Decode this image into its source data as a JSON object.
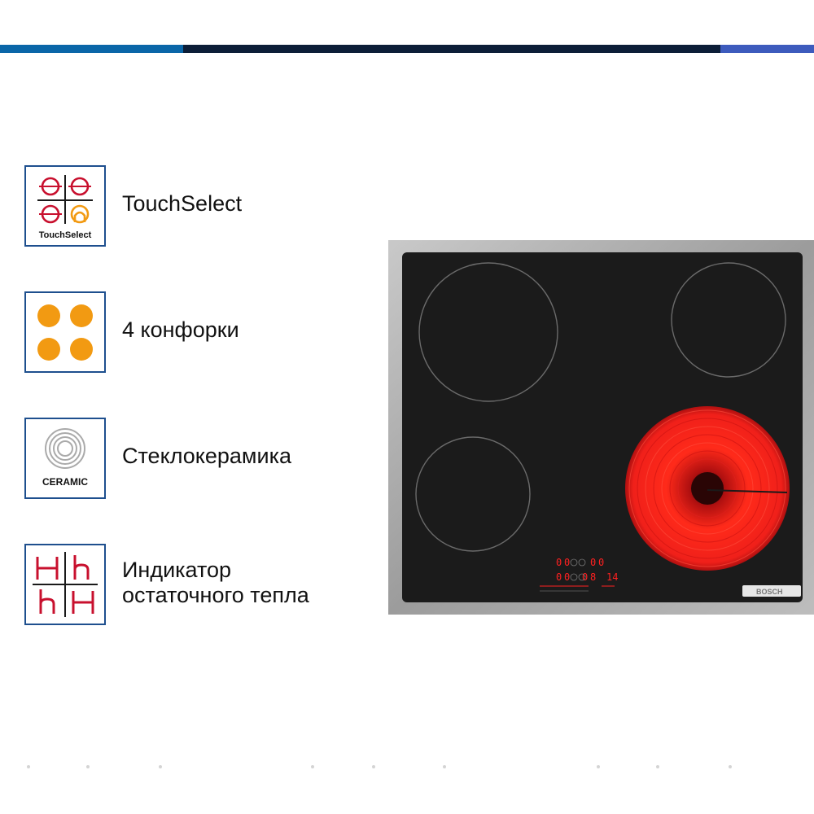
{
  "colors": {
    "bar_light_blue": "#0a66a8",
    "bar_navy": "#0c1e38",
    "bar_blue": "#3d5bbd",
    "icon_border": "#1e4f8e",
    "icon_red": "#c8102e",
    "icon_orange": "#f29a12",
    "burner_red": "#ff2a1a",
    "display_red": "#ff2020"
  },
  "features": [
    {
      "icon": "touchselect-icon",
      "icon_caption": "TouchSelect",
      "label_lines": [
        "TouchSelect"
      ]
    },
    {
      "icon": "four-burners-icon",
      "icon_caption": "",
      "label_lines": [
        "4 конфорки"
      ]
    },
    {
      "icon": "ceramic-icon",
      "icon_caption": "CERAMIC",
      "label_lines": [
        "Стеклокерамика"
      ]
    },
    {
      "icon": "residual-heat-icon",
      "icon_caption": "",
      "label_lines": [
        "Индикатор",
        "остаточного тепла"
      ]
    }
  ],
  "hob": {
    "brand": "BOSCH",
    "zones": [
      {
        "name": "front-left",
        "active": false
      },
      {
        "name": "rear-left",
        "active": false
      },
      {
        "name": "rear-right",
        "active": false
      },
      {
        "name": "front-right",
        "active": true
      }
    ],
    "display": {
      "row1": [
        "0",
        "0",
        "0",
        "0"
      ],
      "row2_left": [
        "0",
        "0"
      ],
      "row2_mid": [
        "0",
        "8"
      ],
      "timer": "14"
    }
  }
}
